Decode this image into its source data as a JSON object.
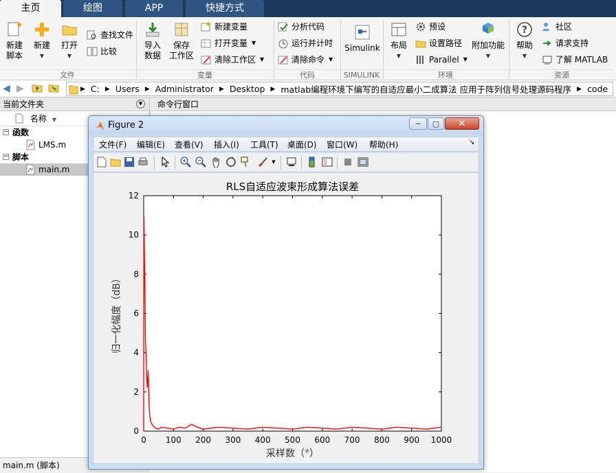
{
  "tabs": [
    {
      "label": "主页"
    },
    {
      "label": "绘图"
    },
    {
      "label": "APP"
    },
    {
      "label": "快捷方式"
    }
  ],
  "ribbon": {
    "file": {
      "new_script": "新建\n脚本",
      "new": "新建",
      "open": "打开",
      "find_files": "查找文件",
      "compare": "比较",
      "label": "文件"
    },
    "variable": {
      "import": "导入\n数据",
      "save_ws": "保存\n工作区",
      "new_var": "新建变量",
      "open_var": "打开变量",
      "clear_ws": "清除工作区",
      "label": "变量"
    },
    "code": {
      "analyze": "分析代码",
      "run_time": "运行并计时",
      "clear_cmd": "清除命令",
      "label": "代码"
    },
    "simulink": {
      "simulink": "Simulink",
      "label": "SIMULINK"
    },
    "env": {
      "layout": "布局",
      "prefs": "预设",
      "set_path": "设置路径",
      "parallel": "Parallel",
      "addons": "附加功能",
      "label": "环境"
    },
    "resources": {
      "help": "帮助",
      "community": "社区",
      "support": "请求支持",
      "learn": "了解 MATLAB",
      "label": "资源"
    }
  },
  "address": {
    "segments": [
      "C:",
      "Users",
      "Administrator",
      "Desktop",
      "matlab编程环境下编写的自适应最小二成算法 应用于阵列信号处理源码程序",
      "code"
    ]
  },
  "left_panel": {
    "title": "当前文件夹",
    "col_name": "名称",
    "groups": [
      {
        "label": "函数",
        "files": [
          "LMS.m"
        ]
      },
      {
        "label": "脚本",
        "files": [
          "main.m"
        ]
      }
    ],
    "status": "main.m  (脚本)"
  },
  "cmd_panel": {
    "title": "命令行窗口"
  },
  "figure": {
    "title": "Figure 2",
    "menus": [
      "文件(F)",
      "编辑(E)",
      "查看(V)",
      "插入(I)",
      "工具(T)",
      "桌面(D)",
      "窗口(W)",
      "帮助(H)"
    ]
  },
  "chart_data": {
    "type": "line",
    "title": "RLS自适应波束形成算法误差",
    "xlabel": "采样数（°）",
    "ylabel": "归一化幅度（dB）",
    "xlim": [
      0,
      1000
    ],
    "ylim": [
      0,
      12
    ],
    "xticks": [
      0,
      100,
      200,
      300,
      400,
      500,
      600,
      700,
      800,
      900,
      1000
    ],
    "yticks": [
      0,
      2,
      4,
      6,
      8,
      10,
      12
    ],
    "color": "#ff0000",
    "series": [
      {
        "x": [
          0,
          1,
          2,
          3,
          4,
          5,
          6,
          8,
          10,
          12,
          15,
          18,
          20,
          23,
          26,
          30,
          35,
          40,
          50,
          60,
          80,
          100,
          120,
          140,
          160,
          180,
          200,
          250,
          300,
          350,
          400,
          450,
          500,
          550,
          600,
          650,
          700,
          750,
          800,
          850,
          900,
          950,
          1000
        ],
        "y": [
          0,
          11,
          9.6,
          8.3,
          7.6,
          6.1,
          4.6,
          3.8,
          2.8,
          2.2,
          3.1,
          1.4,
          0.8,
          0.5,
          0.4,
          0.3,
          0.2,
          0.15,
          0.1,
          0.2,
          0.15,
          0.1,
          0.2,
          0.15,
          0.35,
          0.2,
          0.1,
          0.2,
          0.15,
          0.1,
          0.2,
          0.15,
          0.1,
          0.2,
          0.15,
          0.1,
          0.2,
          0.15,
          0.1,
          0.2,
          0.15,
          0.1,
          0.2
        ]
      }
    ]
  }
}
